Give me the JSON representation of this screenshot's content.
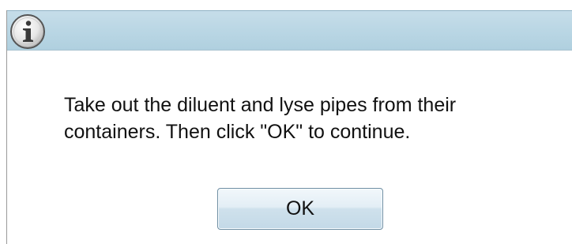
{
  "dialog": {
    "icon": "info-icon",
    "message_lines": [
      "Take out the diluent and lyse pipes from their",
      "containers. Then click \"OK\" to continue."
    ],
    "ok_label": "OK"
  },
  "colors": {
    "titlebar": "#b9d6e4",
    "button_border": "#6f8fa3",
    "text": "#111111"
  }
}
